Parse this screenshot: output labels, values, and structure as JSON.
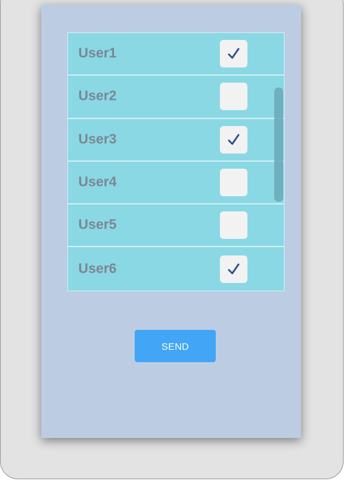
{
  "users": [
    {
      "name": "User1",
      "checked": true
    },
    {
      "name": "User2",
      "checked": false
    },
    {
      "name": "User3",
      "checked": true
    },
    {
      "name": "User4",
      "checked": false
    },
    {
      "name": "User5",
      "checked": false
    },
    {
      "name": "User6",
      "checked": true
    }
  ],
  "send_button": {
    "label": "SEND"
  },
  "icons": {
    "checkbox_checked": "checkmark-icon"
  },
  "colors": {
    "screen_bg": "#bccde3",
    "list_bg": "#8ad8e4",
    "button_bg": "#42a5f5",
    "check_color": "#2f4f86"
  }
}
